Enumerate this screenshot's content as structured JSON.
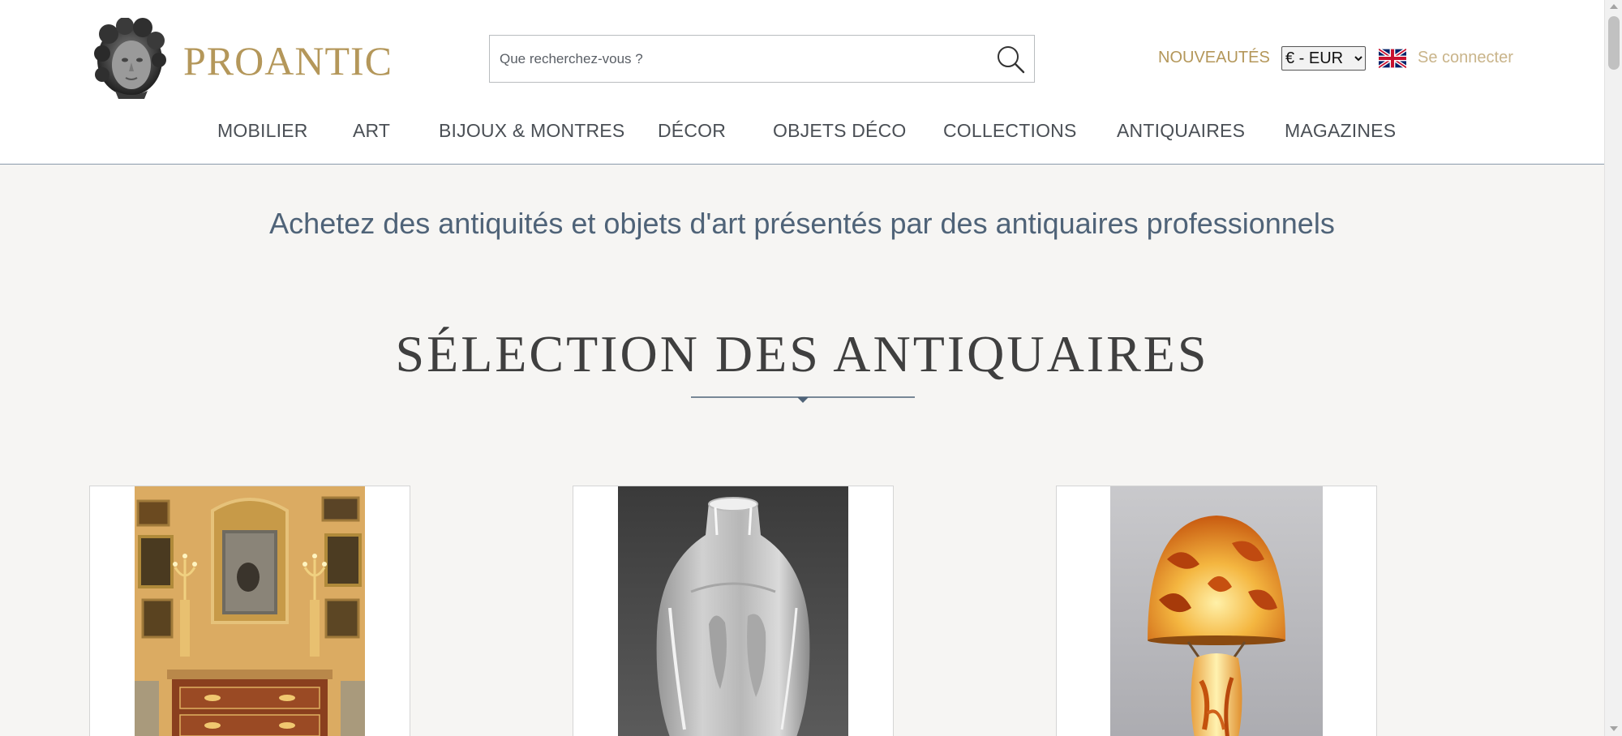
{
  "header": {
    "logo_text": "PROANTIC",
    "search": {
      "placeholder": "Que recherchez-vous ?",
      "value": ""
    },
    "nouveautes_label": "NOUVEAUTÉS",
    "currency": {
      "selected": "€ - EUR",
      "options": [
        "€ - EUR"
      ]
    },
    "language_flag": "uk-flag-icon",
    "login_label": "Se connecter"
  },
  "nav": {
    "items": [
      {
        "label": "MOBILIER"
      },
      {
        "label": "ART"
      },
      {
        "label": "BIJOUX & MONTRES"
      },
      {
        "label": "DÉCOR"
      },
      {
        "label": "OBJETS DÉCO"
      },
      {
        "label": "COLLECTIONS"
      },
      {
        "label": "ANTIQUAIRES"
      },
      {
        "label": "MAGAZINES"
      }
    ]
  },
  "main": {
    "tagline": "Achetez des antiquités et objets d'art présentés par des antiquaires professionnels",
    "section_title": "SÉLECTION DES ANTIQUAIRES",
    "cards": [
      {
        "image": "mirror-and-commode-photo"
      },
      {
        "image": "glass-vase-photo"
      },
      {
        "image": "art-nouveau-lamp-photo"
      }
    ]
  },
  "colors": {
    "brand_gold": "#b4975a",
    "nav_text": "#4a4f55",
    "tagline_blue": "#4f6378",
    "page_bg": "#f6f5f3"
  }
}
